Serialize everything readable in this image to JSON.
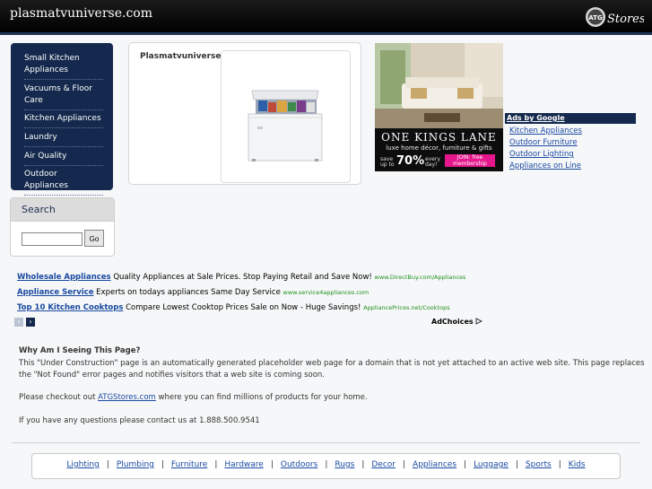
{
  "header": {
    "site_title": "plasmatvuniverse.com",
    "logo_badge": "ATG",
    "logo_text": "Stores"
  },
  "sidebar": {
    "items": [
      {
        "label": "Small Kitchen Appliances"
      },
      {
        "label": "Vacuums & Floor Care"
      },
      {
        "label": "Kitchen Appliances"
      },
      {
        "label": "Laundry"
      },
      {
        "label": "Air Quality"
      },
      {
        "label": "Outdoor Appliances"
      }
    ]
  },
  "search": {
    "title": "Search",
    "input_value": "",
    "button_label": "Go"
  },
  "product": {
    "title": "Plasmatvuniverse"
  },
  "banner_ad": {
    "brand": "ONE KINGS LANE",
    "tagline": "luxe home décor, furniture & gifts",
    "offer_line1": "save",
    "offer_line2": "up to",
    "offer_percent": "70%",
    "offer_every": "every",
    "offer_day": "day!",
    "cta_line1": "JOIN: free",
    "cta_line2": "membership"
  },
  "google_ads": {
    "heading": "Ads by Google",
    "links": [
      {
        "label": "Kitchen Appliances"
      },
      {
        "label": "Outdoor Furniture"
      },
      {
        "label": "Outdoor Lighting"
      },
      {
        "label": "Appliances on Line"
      }
    ]
  },
  "text_ads": [
    {
      "title": "Wholesale Appliances",
      "text": "Quality Appliances at Sale Prices. Stop Paying Retail and Save Now!",
      "url": "www.DirectBuy.com/Appliances"
    },
    {
      "title": "Appliance Service",
      "text": "Experts on todays appliances Same Day Service",
      "url": "www.service4appliances.com"
    },
    {
      "title": "Top 10 Kitchen Cooktops",
      "text": "Compare Lowest Cooktop Prices Sale on Now - Huge Savings!",
      "url": "AppliancePrices.net/Cooktops"
    }
  ],
  "ad_nav": {
    "prev": "‹",
    "next": "›",
    "adchoices": "AdChoices"
  },
  "info": {
    "title": "Why Am I Seeing This Page?",
    "paragraph1_line1": "This \"Under Construction\" page is an automatically generated placeholder web page for a domain that is not yet attached to an active web site. This page replaces",
    "paragraph1_line2": "the \"Not Found\" error pages and notifies visitors that a web site is coming soon.",
    "checkout_before": "Please checkout out ",
    "checkout_link": "ATGStores.com",
    "checkout_after": " where you can find millions of products for your home.",
    "contact": "If you have any questions please contact us at 1.888.500.9541"
  },
  "footer": {
    "separator": "|",
    "links": [
      "Lighting",
      "Plumbing",
      "Furniture",
      "Hardware",
      "Outdoors",
      "Rugs",
      "Decor",
      "Appliances",
      "Luggage",
      "Sports",
      "Kids"
    ]
  }
}
